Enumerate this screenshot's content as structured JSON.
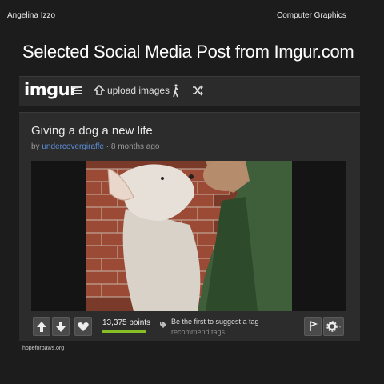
{
  "header": {
    "author": "Angelina Izzo",
    "course": "Computer Graphics"
  },
  "slide": {
    "title": "Selected Social Media Post from Imgur.com"
  },
  "imgur_bar": {
    "logo": "imgur",
    "upload_label": "upload images",
    "icons": [
      "menu-icon",
      "upload-icon",
      "walking-man-icon",
      "shuffle-icon"
    ]
  },
  "post": {
    "title": "Giving a dog a new life",
    "by_prefix": "by ",
    "username": "undercovergiraffe",
    "time": " · 8 months ago",
    "points": "13,375 points",
    "tag_prompt": "Be the first to suggest a tag",
    "tag_sub": "recommend tags"
  },
  "footer": {
    "credit": "hopeforpaws.org"
  },
  "colors": {
    "background": "#1c1c1c",
    "bar": "#2b2b2b",
    "points_bar": "#85bf25",
    "username": "#5d8fd9"
  }
}
